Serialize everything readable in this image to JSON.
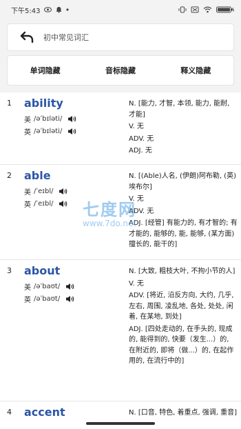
{
  "status_bar": {
    "time": "下午5:43",
    "icons": [
      "eye-icon",
      "notification-icon",
      "dot-icon",
      "vibrate-icon",
      "no-sim-icon",
      "wifi-icon",
      "battery-icon"
    ]
  },
  "header": {
    "back_icon": "back-arrow-icon",
    "title": "初中常见词汇"
  },
  "tabs": [
    {
      "label": "单词隐藏"
    },
    {
      "label": "音标隐藏"
    },
    {
      "label": "释义隐藏"
    }
  ],
  "colors": {
    "headword": "#2b56a6",
    "background": "#f3f3f3",
    "watermark": "#50a0e6"
  },
  "words": [
    {
      "index": "1",
      "word": "ability",
      "us_label": "美",
      "us_ipa": "/əˈbɪləti/",
      "uk_label": "英",
      "uk_ipa": "/əˈbɪləti/",
      "definitions": [
        "N. [能力, 才智, 本领, 能力, 能耐, 才能]",
        "V. 无",
        "ADV. 无",
        "ADJ. 无"
      ]
    },
    {
      "index": "2",
      "word": "able",
      "us_label": "美",
      "us_ipa": "/ˈeɪbl/",
      "uk_label": "英",
      "uk_ipa": "/ˈeɪbl/",
      "definitions": [
        "N. [(Able)人名, (伊朗)阿布勒, (英)埃布尔]",
        "V. 无",
        "ADV. 无",
        "ADJ. [经管] 有能力的, 有才智的; 有才能的, 能够的, 能, 能够, (某方面)擅长的, 能干的]"
      ]
    },
    {
      "index": "3",
      "word": "about",
      "us_label": "美",
      "us_ipa": "/əˈbaʊt/",
      "uk_label": "英",
      "uk_ipa": "/əˈbaʊt/",
      "definitions": [
        "N. [大致, 粗枝大叶, 不拘小节的人]",
        "V. 无",
        "ADV. [将近, 沿反方向, 大约, 几乎, 左右, 周围, 凌乱地, 各处, 处处, 闲着, 在某地, 到处]",
        "ADJ. [四处走动的, 在手头的, 现成的, 能得到的, 快要（发生...）的, 在附近的, 即将（做...）的, 在起作用的, 在流行中的]"
      ]
    },
    {
      "index": "4",
      "word": "accent",
      "definitions": [
        "N. [口音, 特色, 着重点, 强调, 重音]"
      ]
    }
  ],
  "watermark": {
    "main": "七度网",
    "url": "www.7do.net"
  }
}
